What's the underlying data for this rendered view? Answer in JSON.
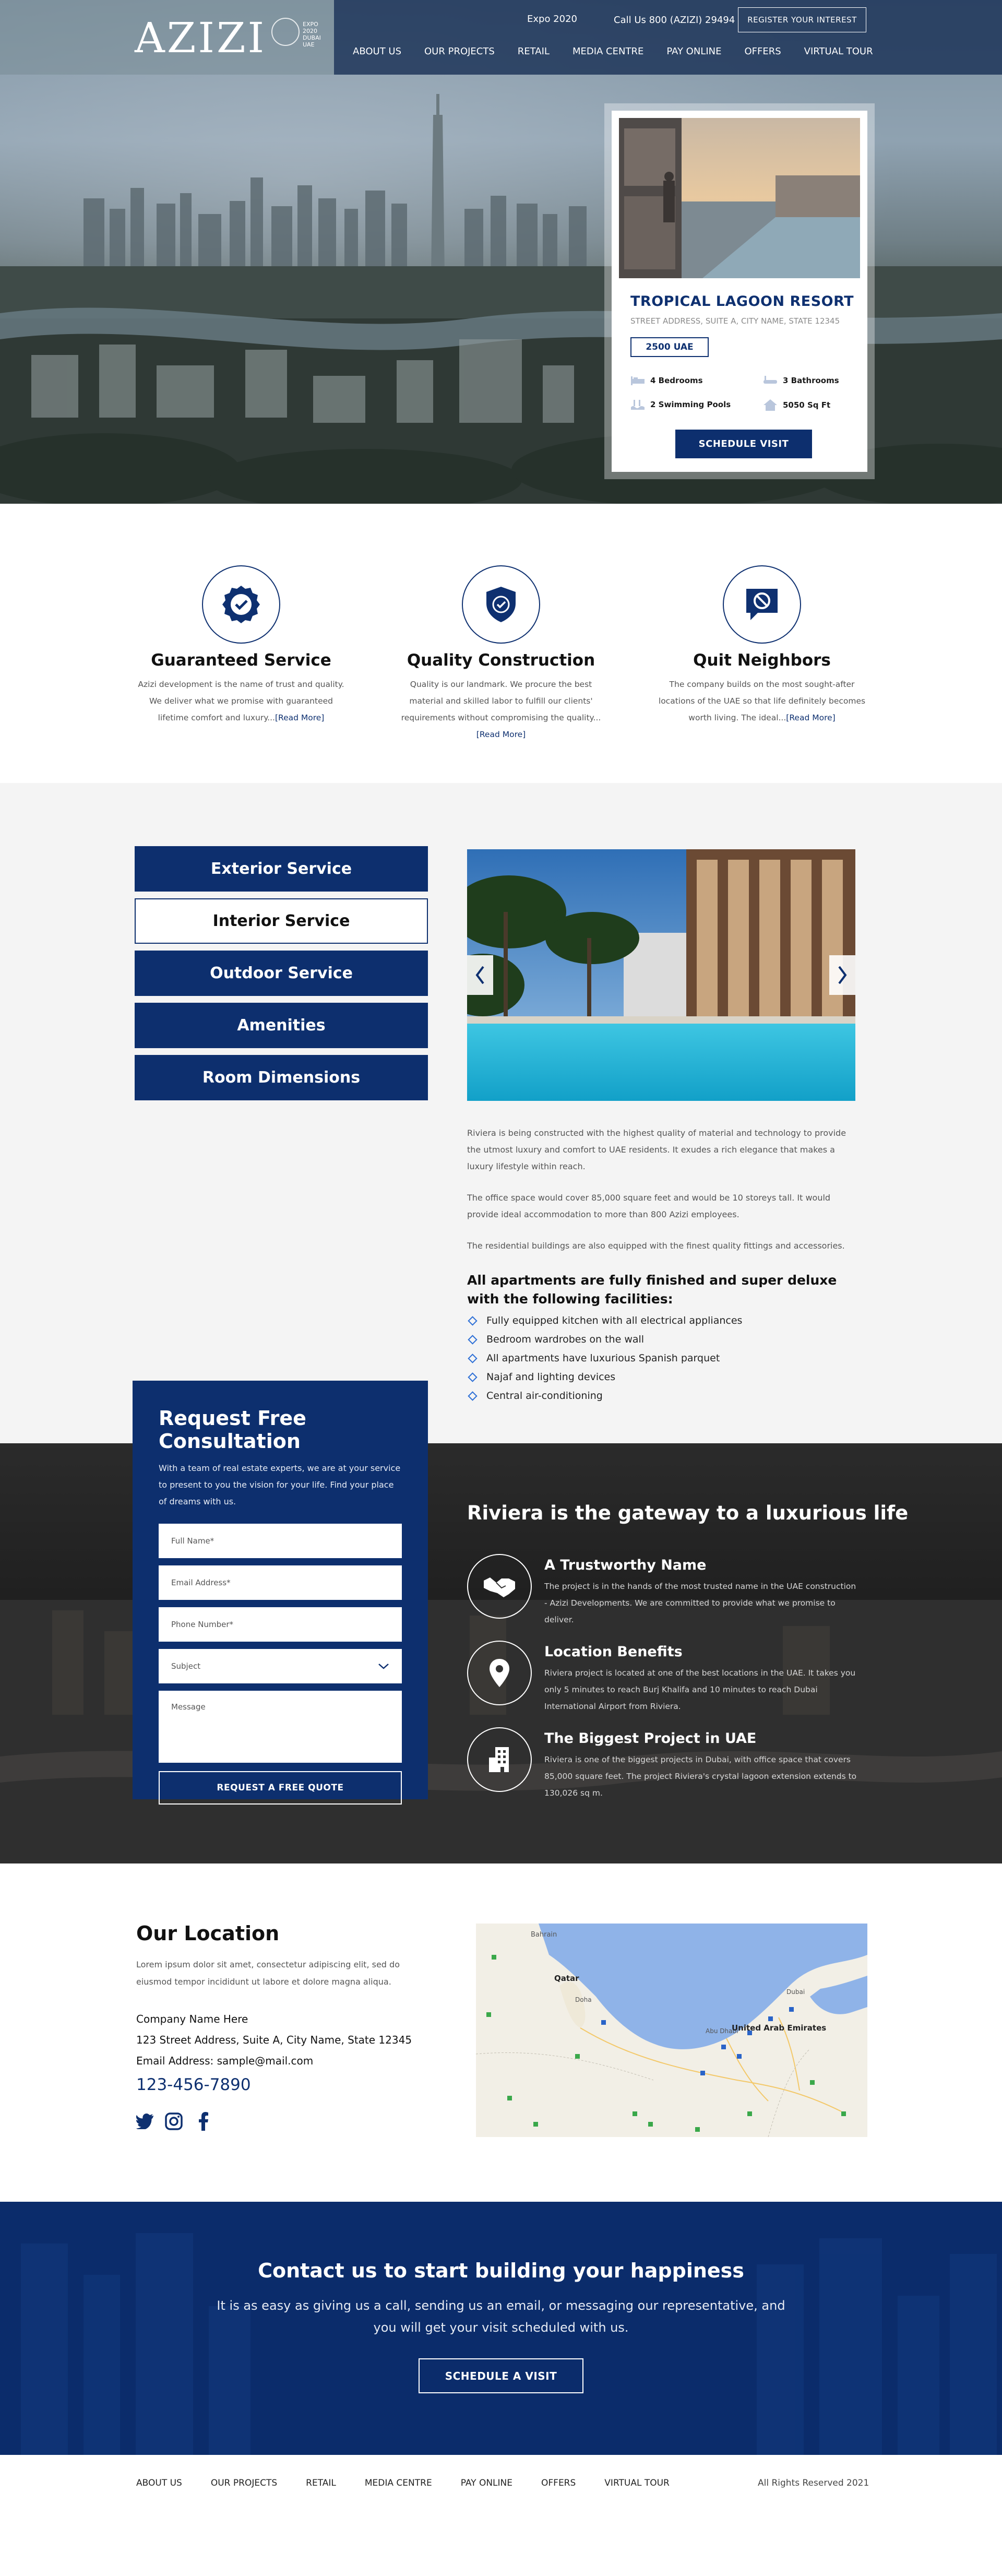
{
  "header": {
    "logo_text": "AZIZI",
    "expo_text": "EXPO 2020 DUBAI UAE",
    "utility": {
      "expo_link": "Expo 2020",
      "call_text": "Call Us 800 (AZIZI) 29494",
      "register_label": "REGISTER YOUR INTEREST"
    },
    "nav": [
      "ABOUT US",
      "OUR PROJECTS",
      "RETAIL",
      "MEDIA CENTRE",
      "PAY ONLINE",
      "OFFERS",
      "VIRTUAL TOUR"
    ]
  },
  "property": {
    "title": "TROPICAL LAGOON RESORT",
    "address": "STREET ADDRESS, SUITE A, CITY NAME, STATE 12345",
    "price": "2500 UAE",
    "features": [
      {
        "icon": "bed-icon",
        "label": "4 Bedrooms"
      },
      {
        "icon": "bathtub-icon",
        "label": "3 Bathrooms"
      },
      {
        "icon": "pool-icon",
        "label": "2 Swimming Pools"
      },
      {
        "icon": "house-icon",
        "label": "5050 Sq Ft"
      }
    ],
    "cta": "SCHEDULE VISIT"
  },
  "features": [
    {
      "icon": "ribbon-check-icon",
      "title": "Guaranteed Service",
      "text": "Azizi development is the name of trust and quality. We deliver what we promise with guaranteed lifetime comfort and luxury...",
      "more": "[Read More]"
    },
    {
      "icon": "shield-check-icon",
      "title": "Quality Construction",
      "text": "Quality is our landmark. We procure the best material and skilled labor to fulfill our clients' requirements without compromising the quality...",
      "more": "[Read More]"
    },
    {
      "icon": "no-speech-icon",
      "title": "Quit Neighbors",
      "text": "The company builds on the most sought-after locations of the UAE so that life definitely becomes worth living. The ideal...",
      "more": "[Read More]"
    }
  ],
  "services": {
    "tabs": [
      "Exterior Service",
      "Interior Service",
      "Outdoor Service",
      "Amenities",
      "Room Dimensions"
    ],
    "active_index": 1,
    "paragraphs": [
      "Riviera is being constructed with the highest quality of material and technology to provide the utmost luxury and comfort to UAE residents. It exudes a rich elegance that makes a luxury lifestyle within reach.",
      "The office space would cover 85,000 square feet and would be 10 storeys tall. It would provide ideal accommodation to more than 800 Azizi employees.",
      "The residential buildings are also equipped with the finest quality fittings and accessories."
    ],
    "heading": "All apartments are fully finished and super deluxe with the following facilities:",
    "list": [
      "Fully equipped kitchen with all electrical appliances",
      "Bedroom wardrobes on the wall",
      "All apartments have luxurious Spanish parquet",
      "Najaf and lighting devices",
      "Central air-conditioning"
    ]
  },
  "consult": {
    "title": "Request Free Consultation",
    "desc": "With a team of real estate experts, we are at your service to present to you the vision for your life. Find your place of dreams with us.",
    "placeholders": {
      "name": "Full Name*",
      "email": "Email Address*",
      "phone": "Phone Number*",
      "subject": "Subject",
      "message": "Message"
    },
    "submit": "REQUEST A FREE QUOTE"
  },
  "luxury": {
    "title": "Riviera is the gateway to a luxurious life",
    "items": [
      {
        "icon": "handshake-icon",
        "title": "A Trustworthy Name",
        "text": "The project is in the hands of the most trusted name in the UAE construction - Azizi Developments. We are committed to provide what we promise to deliver."
      },
      {
        "icon": "location-pin-icon",
        "title": "Location Benefits",
        "text": "Riviera project is located at one of the best locations in the UAE. It takes you only 5 minutes to reach Burj Khalifa and 10 minutes to reach Dubai International Airport from Riviera."
      },
      {
        "icon": "building-icon",
        "title": "The Biggest Project in UAE",
        "text": "Riviera is one of the biggest projects in Dubai, with office space that covers 85,000 square feet. The project Riviera's crystal lagoon extension extends to 130,026 sq m."
      }
    ]
  },
  "location": {
    "title": "Our Location",
    "text": "Lorem ipsum dolor sit amet, consectetur adipiscing elit, sed do eiusmod tempor incididunt ut labore et dolore magna aliqua.",
    "company": "Company Name Here",
    "address": "123 Street Address, Suite A, City Name, State 12345",
    "email": "Email Address: sample@mail.com",
    "phone": "123-456-7890",
    "social": [
      "twitter-icon",
      "instagram-icon",
      "facebook-icon"
    ],
    "map_labels": {
      "bahrain": "Bahrain",
      "qatar": "Qatar",
      "doha": "Doha",
      "uae": "United Arab Emirates",
      "dubai": "Dubai",
      "abudhabi": "Abu Dhabi"
    }
  },
  "contact": {
    "title": "Contact us to start building your happiness",
    "text": "It is as easy as giving us a call, sending us an email, or messaging our representative, and you will get your visit scheduled with us.",
    "cta": "SCHEDULE A VISIT"
  },
  "footer": {
    "nav": [
      "ABOUT US",
      "OUR PROJECTS",
      "RETAIL",
      "MEDIA CENTRE",
      "PAY ONLINE",
      "OFFERS",
      "VIRTUAL TOUR"
    ],
    "rights": "All Rights Reserved 2021"
  },
  "colors": {
    "brand_navy": "#0d2f6e",
    "accent_blue": "#2d6fd6",
    "text_dark": "#111111"
  }
}
